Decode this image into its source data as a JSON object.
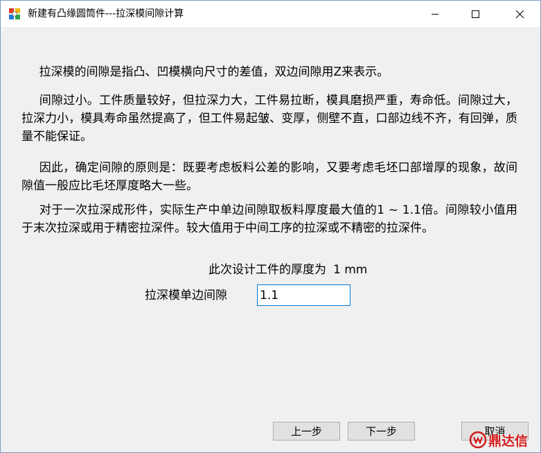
{
  "window": {
    "title": "新建有凸缘圆筒件---拉深模间隙计算",
    "app_icon": "app-icon",
    "controls": {
      "minimize": "minimize-icon",
      "maximize": "maximize-icon",
      "close": "close-icon"
    }
  },
  "content": {
    "paragraphs": [
      "拉深模的间隙是指凸、凹模横向尺寸的差值，双边间隙用Z来表示。",
      "间隙过小。工件质量较好，但拉深力大，工件易拉断，模具磨损严重，寿命低。间隙过大，拉深力小，模具寿命虽然提高了，但工件易起皱、变厚，侧壁不直，口部边线不齐，有回弹，质量不能保证。",
      "因此，确定间隙的原则是：既要考虑板料公差的影响，又要考虑毛坯口部增厚的现象，故间隙值一般应比毛坯厚度略大一些。",
      "对于一次拉深成形件，实际生产中单边间隙取板料厚度最大值的1 ~ 1.1倍。间隙较小值用于末次拉深或用于精密拉深件。较大值用于中间工序的拉深或不精密的拉深件。"
    ],
    "thickness_label": "此次设计工件的厚度为",
    "thickness_value": "1",
    "thickness_unit": "mm",
    "clearance_label": "拉深模单边间隙",
    "clearance_value": "1.1"
  },
  "buttons": {
    "prev": "上一步",
    "next": "下一步",
    "cancel": "取消"
  },
  "watermark": {
    "text": "鼎达信"
  },
  "colors": {
    "input_border": "#0078d7",
    "watermark": "#d11a1a"
  }
}
